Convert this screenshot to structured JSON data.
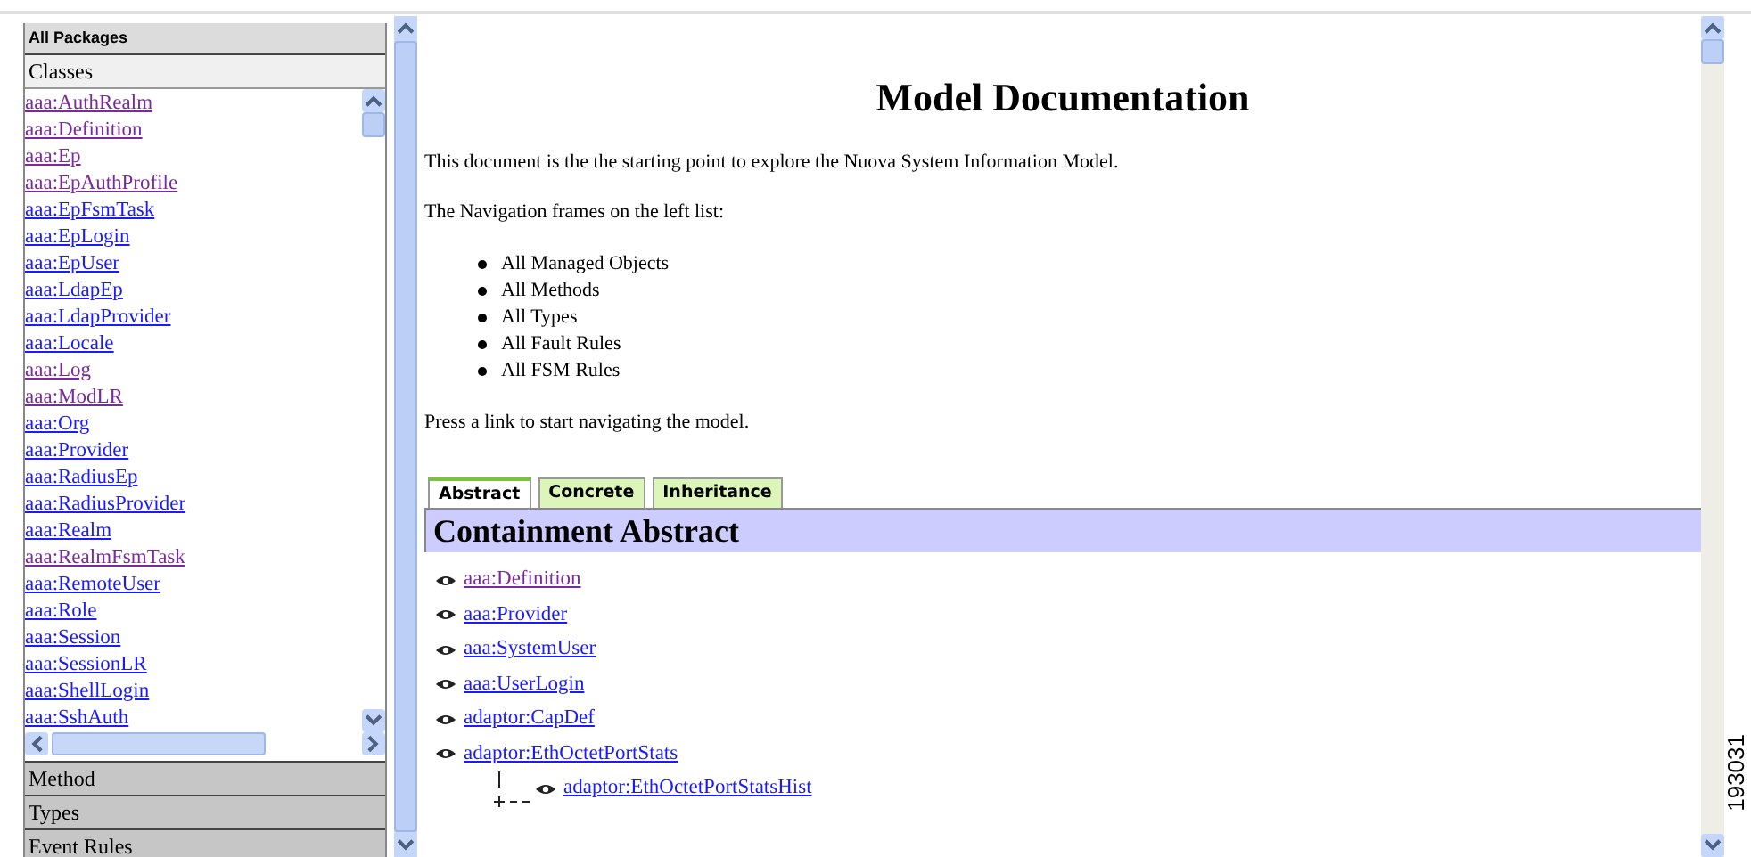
{
  "left_panel": {
    "header": "All Packages",
    "sections": [
      {
        "label": "Classes",
        "expanded": true
      },
      {
        "label": "Method",
        "expanded": false
      },
      {
        "label": "Types",
        "expanded": false
      },
      {
        "label": "Event Rules",
        "expanded": false
      }
    ],
    "classes": [
      {
        "label": "aaa:AuthRealm",
        "visited": true
      },
      {
        "label": "aaa:Definition",
        "visited": true
      },
      {
        "label": "aaa:Ep",
        "visited": true
      },
      {
        "label": "aaa:EpAuthProfile",
        "visited": true
      },
      {
        "label": "aaa:EpFsmTask",
        "visited": false
      },
      {
        "label": "aaa:EpLogin",
        "visited": false
      },
      {
        "label": "aaa:EpUser",
        "visited": false
      },
      {
        "label": "aaa:LdapEp",
        "visited": false
      },
      {
        "label": "aaa:LdapProvider",
        "visited": false
      },
      {
        "label": "aaa:Locale",
        "visited": false
      },
      {
        "label": "aaa:Log",
        "visited": true
      },
      {
        "label": "aaa:ModLR",
        "visited": true
      },
      {
        "label": "aaa:Org",
        "visited": false
      },
      {
        "label": "aaa:Provider",
        "visited": false
      },
      {
        "label": "aaa:RadiusEp",
        "visited": false
      },
      {
        "label": "aaa:RadiusProvider",
        "visited": false
      },
      {
        "label": "aaa:Realm",
        "visited": false
      },
      {
        "label": "aaa:RealmFsmTask",
        "visited": true
      },
      {
        "label": "aaa:RemoteUser",
        "visited": false
      },
      {
        "label": "aaa:Role",
        "visited": false
      },
      {
        "label": "aaa:Session",
        "visited": false
      },
      {
        "label": "aaa:SessionLR",
        "visited": false
      },
      {
        "label": "aaa:ShellLogin",
        "visited": false
      },
      {
        "label": "aaa:SshAuth",
        "visited": false
      }
    ]
  },
  "main": {
    "title": "Model Documentation",
    "intro": "This document is the the starting point to explore the Nuova System Information Model.",
    "nav_note": "The Navigation frames on the left list:",
    "nav_items": [
      "All Managed Objects",
      "All Methods",
      "All Types",
      "All Fault Rules",
      "All FSM Rules"
    ],
    "press_note": "Press a link to start navigating the model.",
    "tabs": [
      {
        "label": "Abstract",
        "selected": true
      },
      {
        "label": "Concrete",
        "selected": false
      },
      {
        "label": "Inheritance",
        "selected": false
      }
    ],
    "section_title": "Containment Abstract",
    "tree": [
      {
        "label": "aaa:Definition",
        "visited": true
      },
      {
        "label": "aaa:Provider",
        "visited": false
      },
      {
        "label": "aaa:SystemUser",
        "visited": false
      },
      {
        "label": "aaa:UserLogin",
        "visited": false
      },
      {
        "label": "adaptor:CapDef",
        "visited": false
      },
      {
        "label": "adaptor:EthOctetPortStats",
        "visited": false,
        "children": [
          {
            "label": "adaptor:EthOctetPortStatsHist",
            "visited": false
          }
        ]
      }
    ]
  },
  "figure_number": "193031"
}
